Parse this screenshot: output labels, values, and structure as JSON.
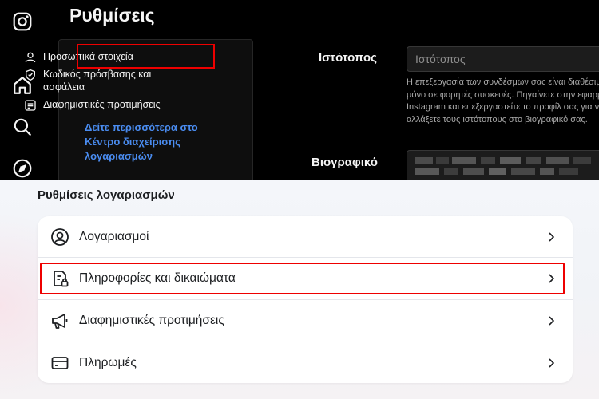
{
  "top": {
    "page_title": "Ρυθμίσεις",
    "menu": [
      {
        "label": "Προσωπικά στοιχεία",
        "icon": "person-icon"
      },
      {
        "label": "Κωδικός πρόσβασης και ασφάλεια",
        "icon": "shield-icon"
      },
      {
        "label": "Διαφημιστικές προτιμήσεις",
        "icon": "ad-preferences-icon"
      }
    ],
    "more_link": "Δείτε περισσότερα στο Κέντρο διαχείρισης λογαριασμών",
    "website_label": "Ιστότοπος",
    "website_placeholder": "Ιστότοπος",
    "website_help": [
      "Η επεξεργασία των συνδέσμων σας είναι διαθέσιμη",
      "μόνο σε φορητές συσκευές. Πηγαίνετε στην εφαρμογή",
      "Instagram και επεξεργαστείτε το προφίλ σας για να",
      "αλλάξετε τους ιστότοπους στο βιογραφικό σας."
    ],
    "bio_label": "Βιογραφικό"
  },
  "bottom": {
    "section_title": "Ρυθμίσεις λογαριασμών",
    "rows": [
      {
        "label": "Λογαριασμοί",
        "icon": "account-circle-icon"
      },
      {
        "label": "Πληροφορίες και δικαιώματα",
        "icon": "info-permissions-icon"
      },
      {
        "label": "Διαφημιστικές προτιμήσεις",
        "icon": "megaphone-icon"
      },
      {
        "label": "Πληρωμές",
        "icon": "credit-card-icon"
      }
    ]
  },
  "colors": {
    "link": "#4a8cf0",
    "highlight": "#e00000",
    "dark_bg": "#000000"
  }
}
